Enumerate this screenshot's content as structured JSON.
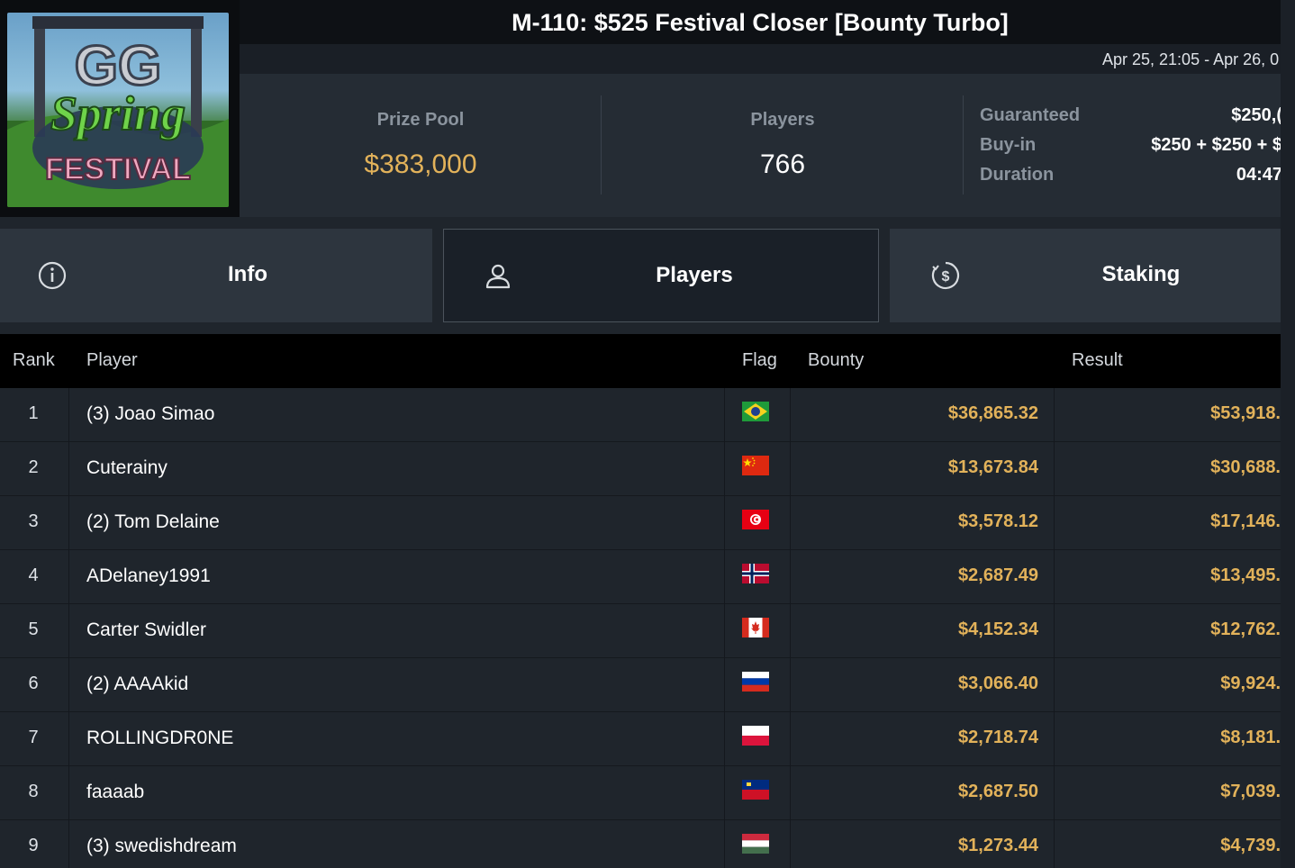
{
  "header": {
    "logo_text": "GG Spring FESTIVAL",
    "title": "M-110: $525 Festival Closer [Bounty Turbo]",
    "date_range": "Apr 25, 21:05 - Apr 26, 0"
  },
  "stats": {
    "prize_pool_label": "Prize Pool",
    "prize_pool_value": "$383,000",
    "players_label": "Players",
    "players_value": "766",
    "guaranteed_label": "Guaranteed",
    "guaranteed_value": "$250,(",
    "buyin_label": "Buy-in",
    "buyin_value": "$250 + $250 + $",
    "duration_label": "Duration",
    "duration_value": "04:47"
  },
  "tabs": [
    {
      "label": "Info",
      "icon": "info-icon"
    },
    {
      "label": "Players",
      "icon": "user-icon"
    },
    {
      "label": "Staking",
      "icon": "dollar-icon"
    }
  ],
  "table": {
    "headers": {
      "rank": "Rank",
      "player": "Player",
      "flag": "Flag",
      "bounty": "Bounty",
      "result": "Result"
    },
    "rows": [
      {
        "rank": "1",
        "player": "(3) Joao Simao",
        "flag": "brazil",
        "bounty": "$36,865.32",
        "result": "$53,918."
      },
      {
        "rank": "2",
        "player": "Cuterainy",
        "flag": "china",
        "bounty": "$13,673.84",
        "result": "$30,688."
      },
      {
        "rank": "3",
        "player": "(2) Tom Delaine",
        "flag": "tunisia",
        "bounty": "$3,578.12",
        "result": "$17,146."
      },
      {
        "rank": "4",
        "player": "ADelaney1991",
        "flag": "norway",
        "bounty": "$2,687.49",
        "result": "$13,495."
      },
      {
        "rank": "5",
        "player": "Carter Swidler",
        "flag": "canada",
        "bounty": "$4,152.34",
        "result": "$12,762."
      },
      {
        "rank": "6",
        "player": "(2) AAAAkid",
        "flag": "russia",
        "bounty": "$3,066.40",
        "result": "$9,924."
      },
      {
        "rank": "7",
        "player": "ROLLINGDR0NE",
        "flag": "poland",
        "bounty": "$2,718.74",
        "result": "$8,181."
      },
      {
        "rank": "8",
        "player": "faaaab",
        "flag": "liechtenstein",
        "bounty": "$2,687.50",
        "result": "$7,039."
      },
      {
        "rank": "9",
        "player": "(3) swedishdream",
        "flag": "hungary",
        "bounty": "$1,273.44",
        "result": "$4,739."
      }
    ]
  },
  "colors": {
    "gold": "#e2b25a",
    "bg": "#1f252c",
    "header_bg": "#000000"
  }
}
